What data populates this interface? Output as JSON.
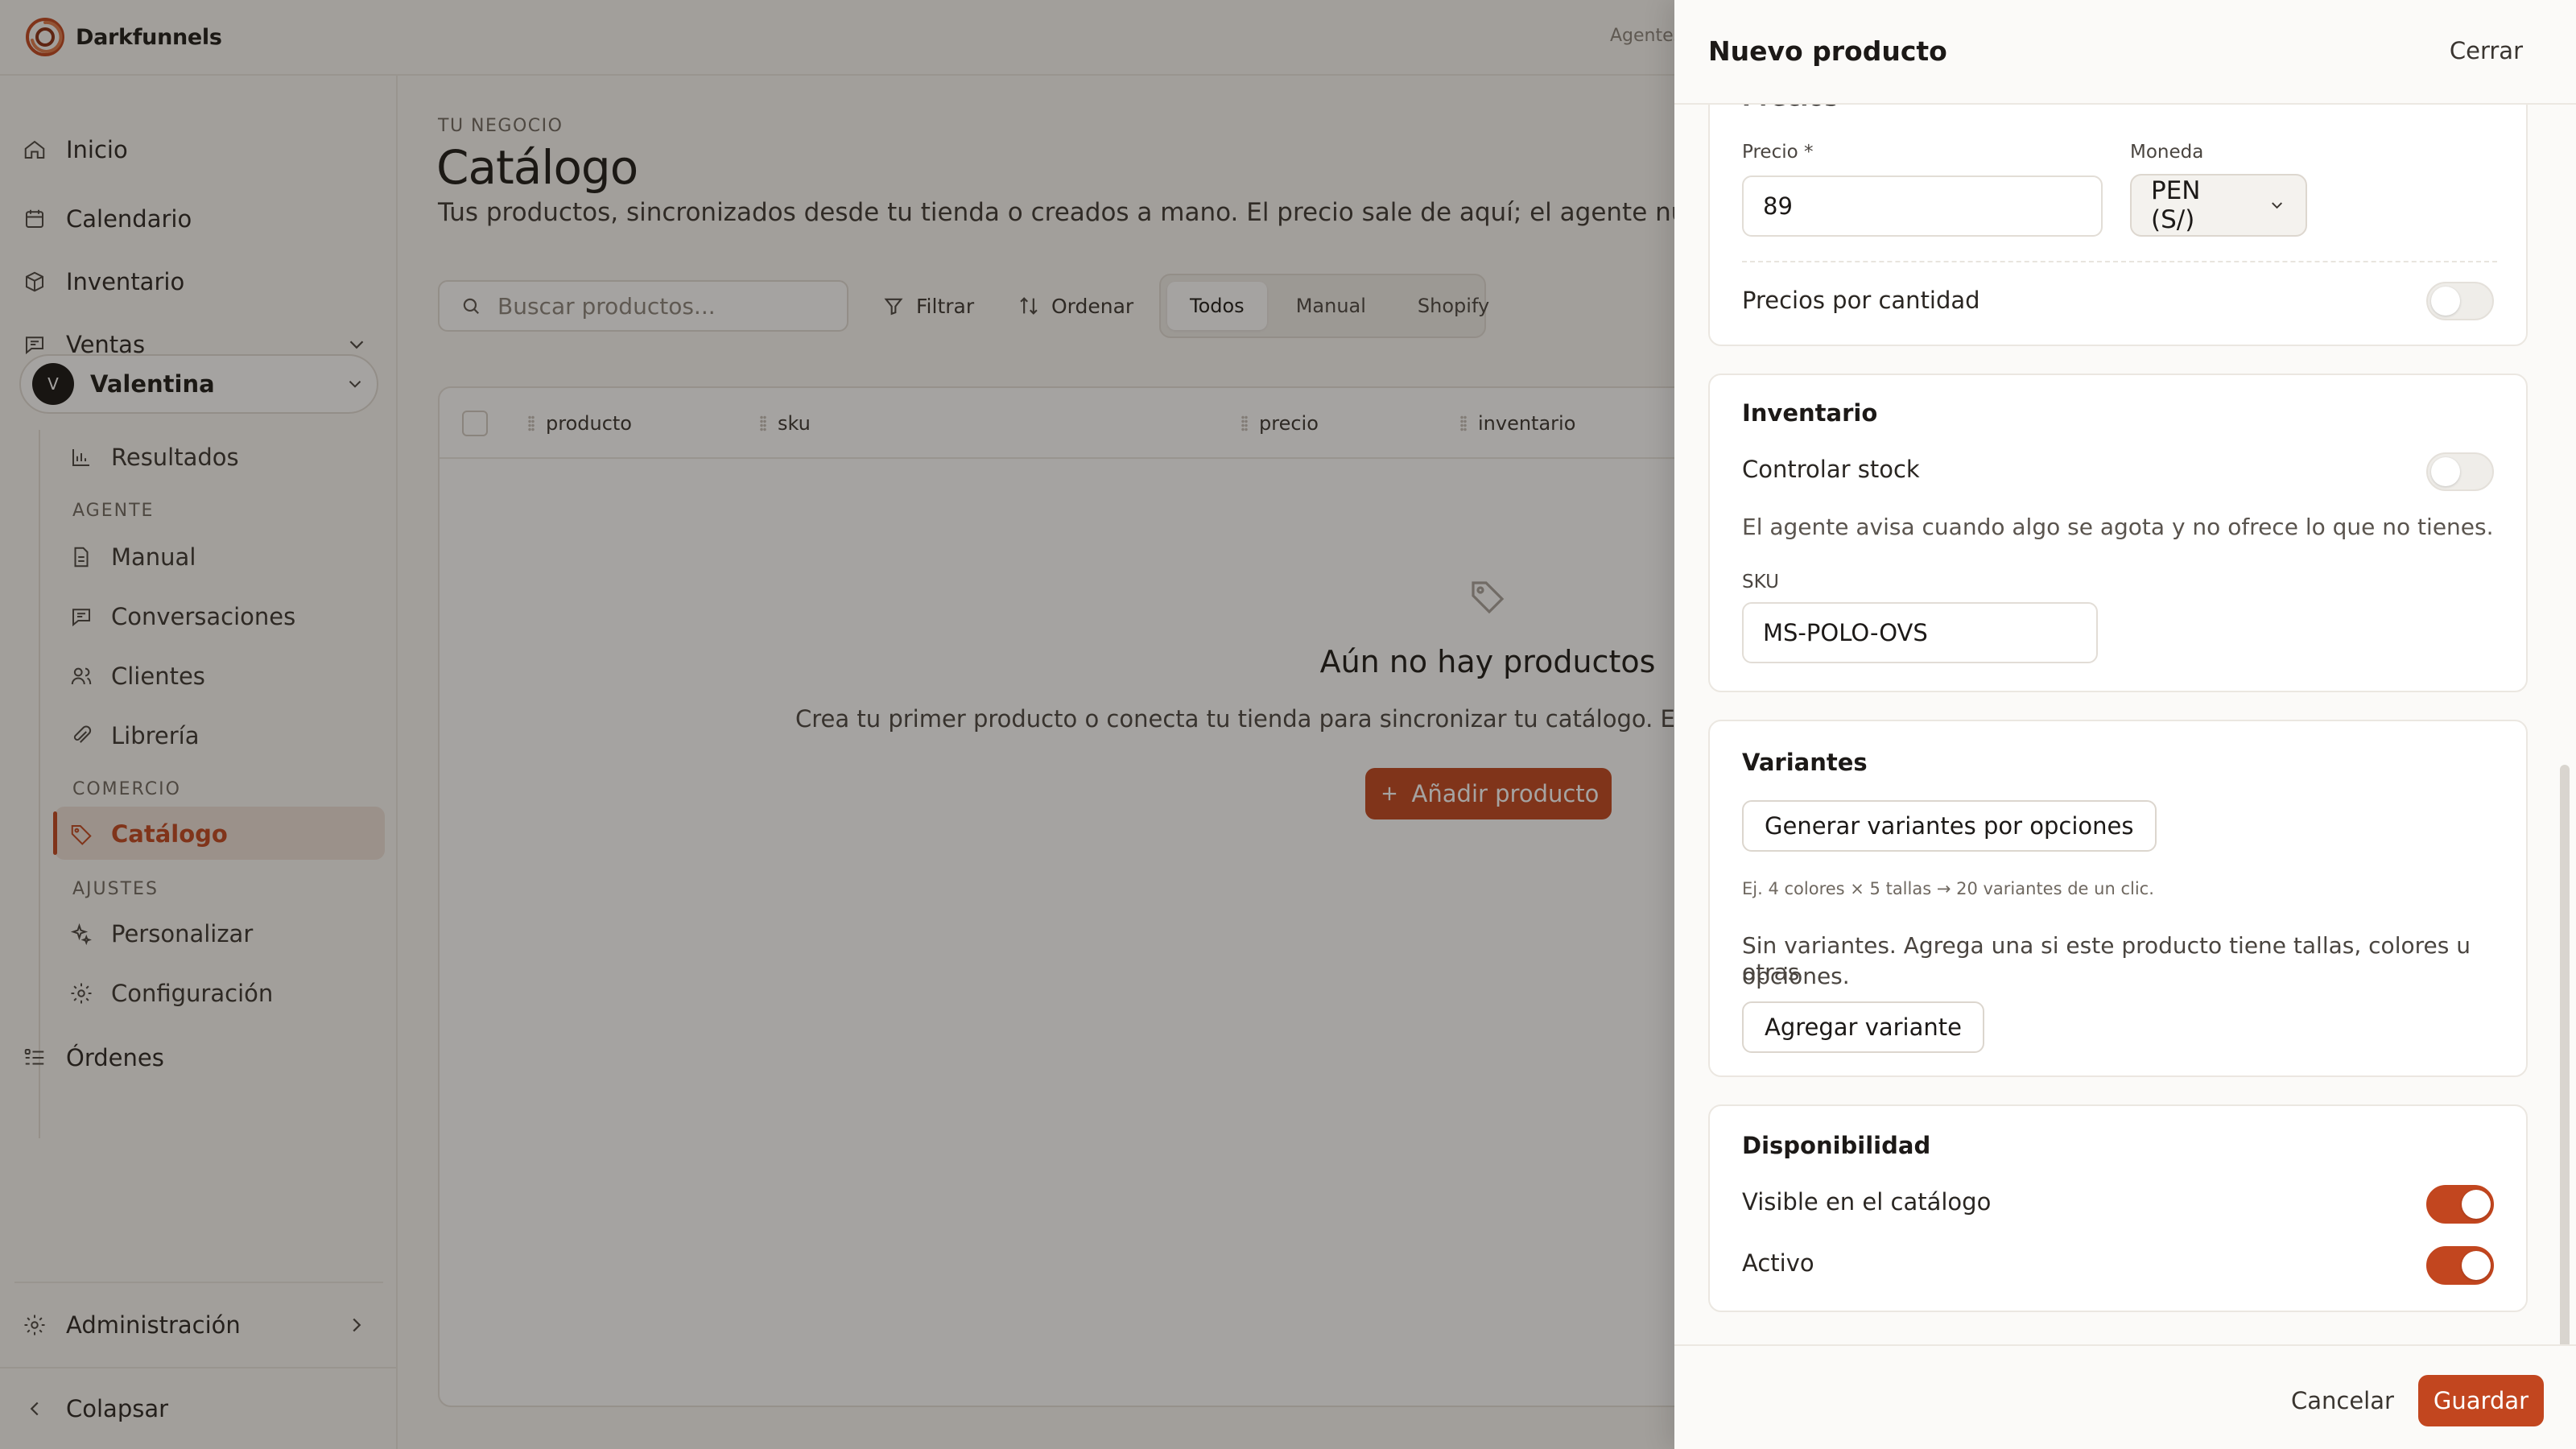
{
  "app": {
    "brand": "Darkfunnels",
    "top_link": "Agentes"
  },
  "sidebar": {
    "inicio": "Inicio",
    "calendario": "Calendario",
    "inventario": "Inventario",
    "ventas": "Ventas",
    "user": {
      "initial": "V",
      "name": "Valentina"
    },
    "resultados": "Resultados",
    "section_agente": "AGENTE",
    "manual": "Manual",
    "conversaciones": "Conversaciones",
    "clientes": "Clientes",
    "libreria": "Librería",
    "section_comercio": "COMERCIO",
    "catalogo": "Catálogo",
    "section_ajustes": "AJUSTES",
    "personalizar": "Personalizar",
    "configuracion": "Configuración",
    "ordenes": "Órdenes",
    "administracion": "Administración",
    "colapsar": "Colapsar"
  },
  "main": {
    "eyebrow": "TU NEGOCIO",
    "title": "Catálogo",
    "description": "Tus productos, sincronizados desde tu tienda o creados a mano. El precio sale de aquí; el agente nunca lo",
    "search_placeholder": "Buscar productos...",
    "filter": "Filtrar",
    "sort": "Ordenar",
    "tabs": [
      "Todos",
      "Manual",
      "Shopify"
    ],
    "columns": [
      "producto",
      "sku",
      "precio",
      "inventario"
    ],
    "empty_title": "Aún no hay productos",
    "empty_desc": "Crea tu primer producto o conecta tu tienda para sincronizar tu catálogo. El precio que",
    "add_button": "Añadir producto"
  },
  "drawer": {
    "title": "Nuevo producto",
    "close": "Cerrar",
    "pricing": {
      "section_title": "Precios",
      "price_label": "Precio *",
      "price_value": "89",
      "currency_label": "Moneda",
      "currency_value": "PEN (S/)",
      "tiered_label": "Precios por cantidad",
      "tiered_enabled": false
    },
    "inventory": {
      "title": "Inventario",
      "track_label": "Controlar stock",
      "track_enabled": false,
      "hint": "El agente avisa cuando algo se agota y no ofrece lo que no tienes.",
      "sku_label": "SKU",
      "sku_value": "MS-POLO-OVS"
    },
    "variants": {
      "title": "Variantes",
      "generate_button": "Generar variantes por opciones",
      "example": "Ej. 4 colores × 5 tallas → 20 variantes de un clic.",
      "empty_line1": "Sin variantes. Agrega una si este producto tiene tallas, colores u otras",
      "empty_line2": "opciones.",
      "add_button": "Agregar variante"
    },
    "availability": {
      "title": "Disponibilidad",
      "visible_label": "Visible en el catálogo",
      "visible_enabled": true,
      "active_label": "Activo",
      "active_enabled": true
    },
    "cancel": "Cancelar",
    "save": "Guardar"
  },
  "colors": {
    "accent": "#c2461f",
    "background": "#faf8f5",
    "card": "#ffffff",
    "border": "#ece8e2"
  }
}
